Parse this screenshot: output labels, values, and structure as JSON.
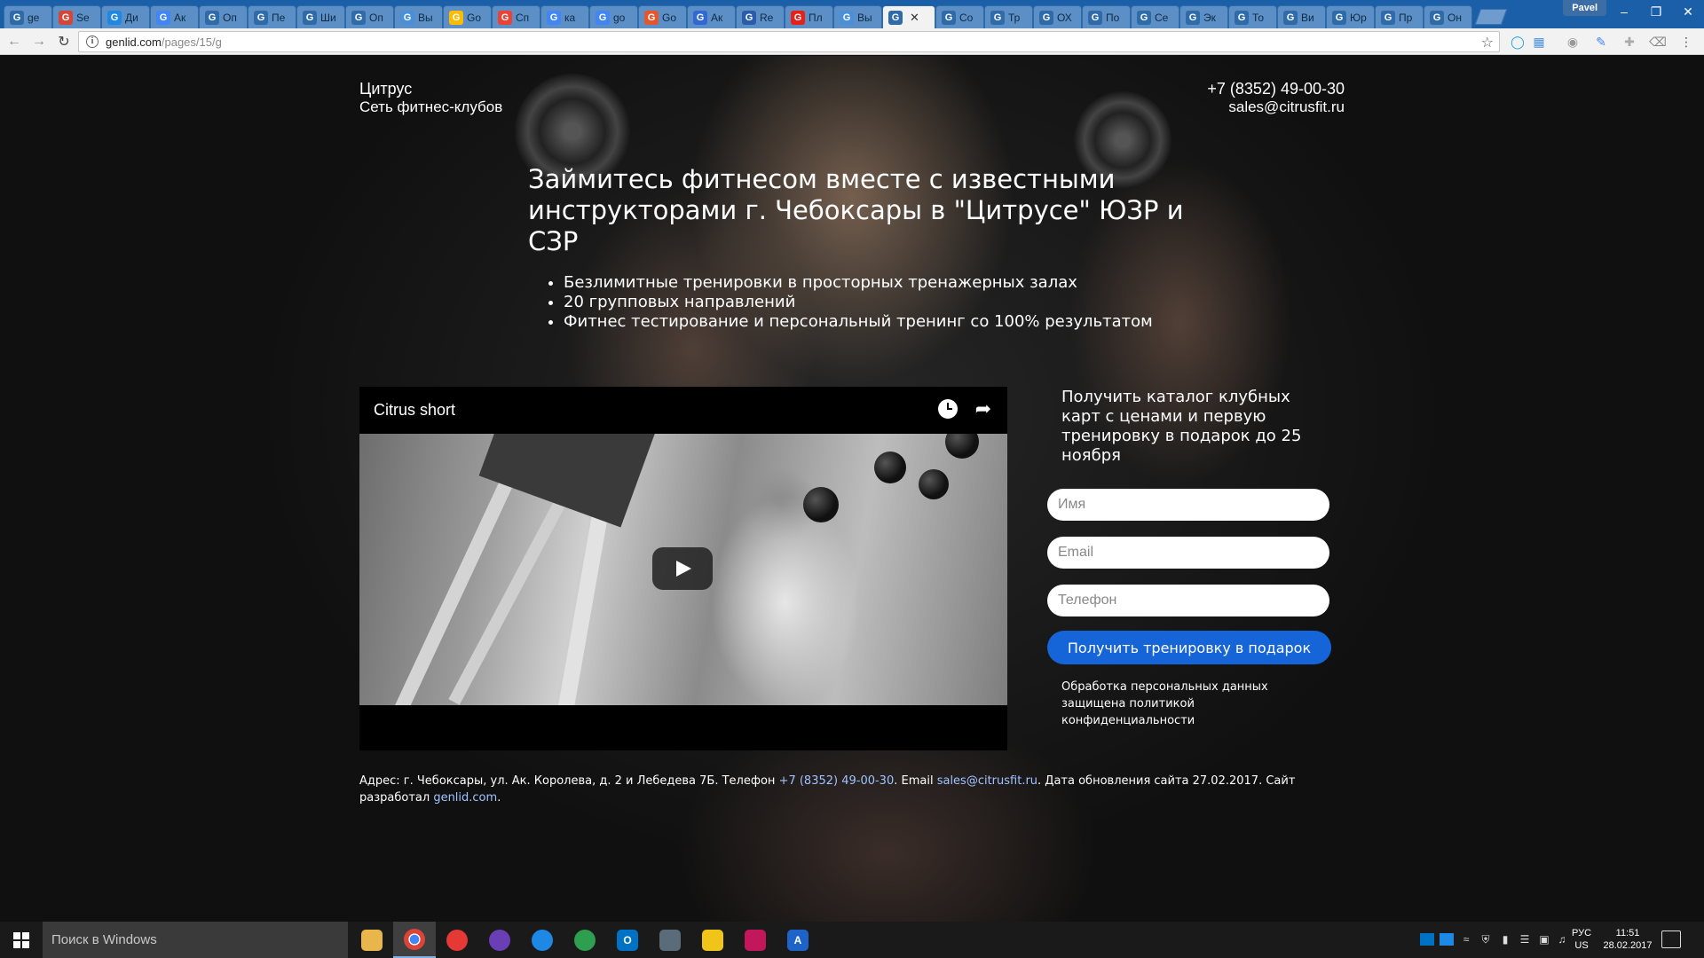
{
  "browser": {
    "tabs": [
      {
        "label": "ge",
        "icon": "genlid-g-icon",
        "color": "#2f6aa9"
      },
      {
        "label": "Se",
        "icon": "gmail-icon",
        "color": "#d44638"
      },
      {
        "label": "Ди",
        "icon": "dialog-icon",
        "color": "#1e88e5"
      },
      {
        "label": "Ак",
        "icon": "adwords-icon",
        "color": "#4285f4"
      },
      {
        "label": "Оп",
        "icon": "genlid-g-icon",
        "color": "#2f6aa9"
      },
      {
        "label": "Пе",
        "icon": "genlid-g-icon",
        "color": "#2f6aa9"
      },
      {
        "label": "Ши",
        "icon": "genlid-g-icon",
        "color": "#2f6aa9"
      },
      {
        "label": "Оп",
        "icon": "genlid-g-icon",
        "color": "#2f6aa9"
      },
      {
        "label": "Вы",
        "icon": "chat-icon",
        "color": "#4a90d9"
      },
      {
        "label": "Go",
        "icon": "google-icon",
        "color": "#fbbc05"
      },
      {
        "label": "Сп",
        "icon": "maps-pin-icon",
        "color": "#ea4335"
      },
      {
        "label": "ка",
        "icon": "google-g-icon",
        "color": "#4285f4"
      },
      {
        "label": "go",
        "icon": "google-g-icon",
        "color": "#4285f4"
      },
      {
        "label": "Go",
        "icon": "f-icon",
        "color": "#e4572e"
      },
      {
        "label": "Ак",
        "icon": "globe-icon",
        "color": "#3367d6"
      },
      {
        "label": "Re",
        "icon": "b-icon",
        "color": "#2a5caa"
      },
      {
        "label": "Пл",
        "icon": "youtube-icon",
        "color": "#e62117"
      },
      {
        "label": "Вы",
        "icon": "chat-icon",
        "color": "#4a90d9"
      },
      {
        "label": "",
        "icon": "genlid-g-icon",
        "color": "#2f6aa9",
        "active": true
      },
      {
        "label": "Со",
        "icon": "genlid-g-icon",
        "color": "#2f6aa9"
      },
      {
        "label": "Тр",
        "icon": "genlid-g-icon",
        "color": "#2f6aa9"
      },
      {
        "label": "ОХ",
        "icon": "genlid-g-icon",
        "color": "#2f6aa9"
      },
      {
        "label": "По",
        "icon": "genlid-g-icon",
        "color": "#2f6aa9"
      },
      {
        "label": "Се",
        "icon": "genlid-g-icon",
        "color": "#2f6aa9"
      },
      {
        "label": "Эк",
        "icon": "genlid-g-icon",
        "color": "#2f6aa9"
      },
      {
        "label": "То",
        "icon": "genlid-g-icon",
        "color": "#2f6aa9"
      },
      {
        "label": "Ви",
        "icon": "genlid-g-icon",
        "color": "#2f6aa9"
      },
      {
        "label": "Юр",
        "icon": "genlid-g-icon",
        "color": "#2f6aa9"
      },
      {
        "label": "Пр",
        "icon": "genlid-g-icon",
        "color": "#2f6aa9"
      },
      {
        "label": "Он",
        "icon": "genlid-g-icon",
        "color": "#2f6aa9"
      }
    ],
    "profile_name": "Pavel",
    "url_host": "genlid.com",
    "url_path": "/pages/15/g"
  },
  "site": {
    "brand_name": "Цитрус",
    "brand_subtitle": "Сеть фитнес-клубов",
    "phone": "+7 (8352) 49-00-30",
    "email": "sales@citrusfit.ru",
    "headline": "Займитесь фитнесом вместе с известными инструкторами г. Чебоксары в \"Цитрусе\" ЮЗР и СЗР",
    "bullets": [
      "Безлимитные тренировки в просторных тренажерных залах",
      "20 групповых направлений",
      "Фитнес тестирование и персональный тренинг со 100% результатом"
    ],
    "video_title": "Citrus short",
    "form": {
      "title": "Получить каталог клубных карт с ценами и первую тренировку в подарок до 25 ноября",
      "name_placeholder": "Имя",
      "email_placeholder": "Email",
      "phone_placeholder": "Телефон",
      "submit_label": "Получить тренировку в подарок",
      "privacy_note": "Обработка персональных данных защищена политикой конфиденциальности"
    },
    "footer": {
      "address_prefix": "Адрес: г. Чебоксары, ул. Ак. Королева, д. 2 и Лебедева 7Б. Телефон ",
      "phone_link": "+7 (8352) 49-00-30",
      "email_prefix": ". Email ",
      "email_link": "sales@citrusfit.ru",
      "updated_text": ". Дата обновления сайта 27.02.2017. Сайт разработал ",
      "dev_link": "genlid.com",
      "end": "."
    }
  },
  "taskbar": {
    "search_placeholder": "Поиск в Windows",
    "lang": "РУС",
    "layout": "US",
    "time": "11:51",
    "date": "28.02.2017"
  }
}
